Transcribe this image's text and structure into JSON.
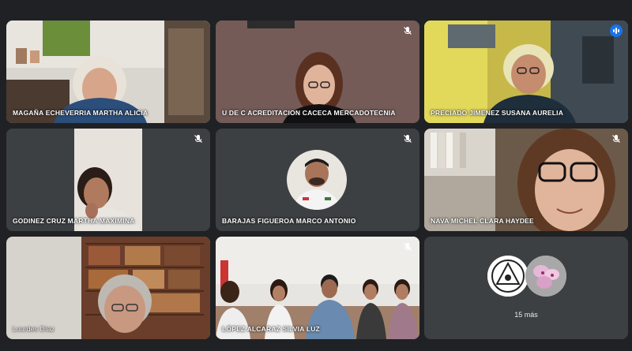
{
  "participants": [
    {
      "name": "MAGAÑA ECHEVERRIA MARTHA ALICIA",
      "muted": false,
      "speaking": false
    },
    {
      "name": "U DE C ACREDITACION CACECA MERCADOTECNIA",
      "muted": true,
      "speaking": false
    },
    {
      "name": "PRECIADO JIMENEZ SUSANA AURELIA",
      "muted": false,
      "speaking": true
    },
    {
      "name": "GODINEZ CRUZ MARTHA MAXIMINA",
      "muted": true,
      "speaking": false
    },
    {
      "name": "BARAJAS FIGUEROA MARCO ANTONIO",
      "muted": true,
      "speaking": false
    },
    {
      "name": "NAVA MICHEL CLARA HAYDEE",
      "muted": true,
      "speaking": false
    },
    {
      "name": "Lourdes Díaz",
      "muted": false,
      "speaking": false
    },
    {
      "name": "LÓPEZ ALCARAZ SILVIA LUZ",
      "muted": true,
      "speaking": false
    }
  ],
  "overflow": {
    "label": "15 más"
  },
  "colors": {
    "background": "#202124",
    "tile": "#3c4043",
    "speaking_outline": "#8ab4f8",
    "badge": "#1a73e8"
  },
  "icons": {
    "muted": "mic-off-icon",
    "speaking": "audio-level-icon"
  }
}
